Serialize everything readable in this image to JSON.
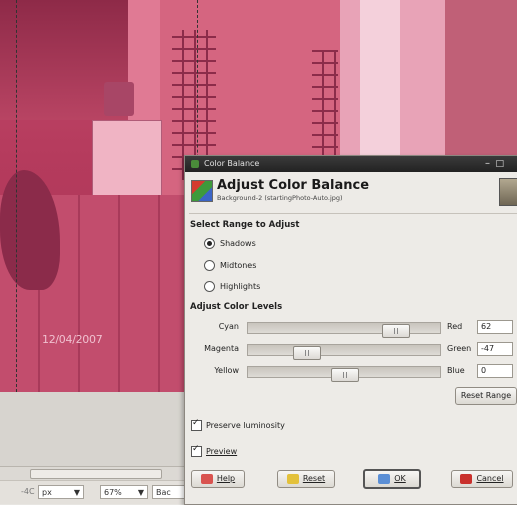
{
  "photo": {
    "datestamp": "12/04/2007"
  },
  "statusbar": {
    "coord": "-4C",
    "unit": "px",
    "zoom": "67%",
    "layer": "Bac"
  },
  "dialog": {
    "window_title": "Color Balance",
    "title": "Adjust Color Balance",
    "subtitle": "Background-2 (startingPhoto-Auto.jpg)",
    "range_section": "Select Range to Adjust",
    "ranges": [
      {
        "label": "Shadows",
        "selected": true
      },
      {
        "label": "Midtones",
        "selected": false
      },
      {
        "label": "Highlights",
        "selected": false
      }
    ],
    "levels_section": "Adjust Color Levels",
    "sliders": [
      {
        "left": "Cyan",
        "right": "Red",
        "value": "62",
        "fraction": 0.81
      },
      {
        "left": "Magenta",
        "right": "Green",
        "value": "-47",
        "fraction": 0.27
      },
      {
        "left": "Yellow",
        "right": "Blue",
        "value": "0",
        "fraction": 0.5
      }
    ],
    "reset_range": "Reset Range",
    "preserve_luminosity": {
      "label": "Preserve luminosity",
      "checked": true
    },
    "preview": {
      "label": "Preview",
      "checked": true
    },
    "buttons": {
      "help": "Help",
      "reset": "Reset",
      "ok": "OK",
      "cancel": "Cancel"
    }
  }
}
